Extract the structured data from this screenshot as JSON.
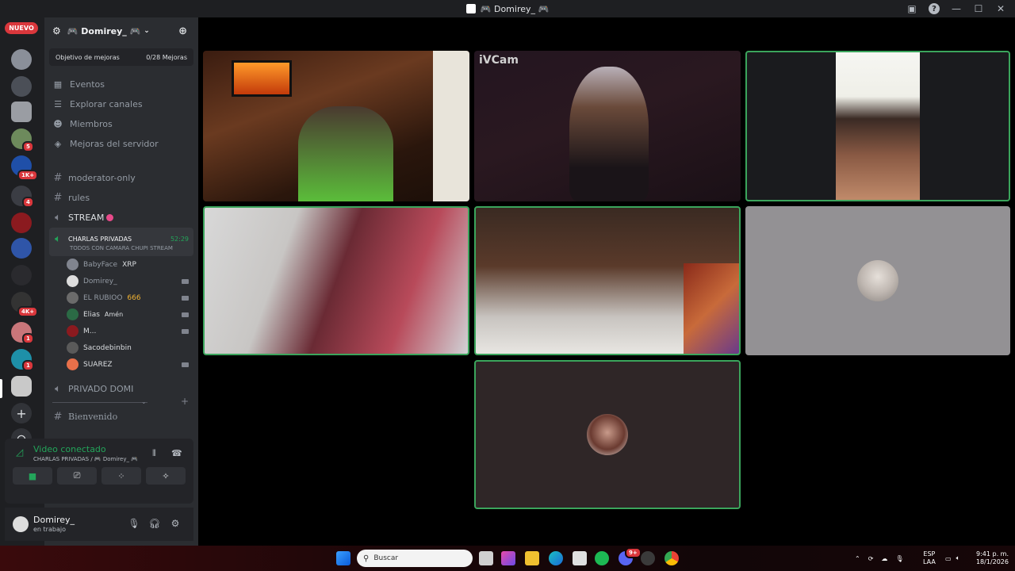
{
  "window": {
    "title": "🎮 Domirey_ 🎮"
  },
  "servers": {
    "new_label": "NUEVO",
    "badges": [
      "5",
      "1K+",
      "4",
      "4K+",
      "1",
      "1"
    ]
  },
  "guild": {
    "name": "🎮 Domirey_ 🎮",
    "boost_label": "Objetivo de mejoras",
    "boost_progress": "0/28 Mejoras",
    "menu": [
      "Eventos",
      "Explorar canales",
      "Miembros",
      "Mejoras del servidor"
    ],
    "channels": {
      "text1": "moderator-only",
      "text2": "rules",
      "voice1": "STREAM",
      "active_name": "CHARLAS PRIVADAS",
      "active_time": "52:29",
      "active_status": "TODOS CON CAMARA CHUPI STREAM",
      "voice_users": [
        {
          "name": "BabyFace",
          "extra": "XRP"
        },
        {
          "name": "Domirey_",
          "extra": ""
        },
        {
          "name": "EL RUBIOO",
          "extra": "666"
        },
        {
          "name": "Elias",
          "extra": "Amén"
        },
        {
          "name": "M...",
          "extra": ""
        },
        {
          "name": "Sacodebinbin",
          "extra": ""
        },
        {
          "name": "SUAREZ",
          "extra": ""
        }
      ],
      "voice2": "PRIVADO DOMI",
      "text3": "Bienvenido"
    }
  },
  "voice_panel": {
    "status": "Video conectado",
    "sub": "CHARLAS PRIVADAS / 🎮 Domirey_ 🎮"
  },
  "user_panel": {
    "name": "Domirey_",
    "status": "en trabajo"
  },
  "tiles": {
    "tile2_label": "iVCam"
  },
  "taskbar": {
    "search_placeholder": "Buscar",
    "lang1": "ESP",
    "lang2": "LAA",
    "time": "9:41 p. m.",
    "date": "18/1/2026",
    "discord_badge": "9+"
  },
  "colors": {
    "accent_green": "#3ba55c",
    "discord_blurple": "#5865f2",
    "red_badge": "#da373c"
  }
}
